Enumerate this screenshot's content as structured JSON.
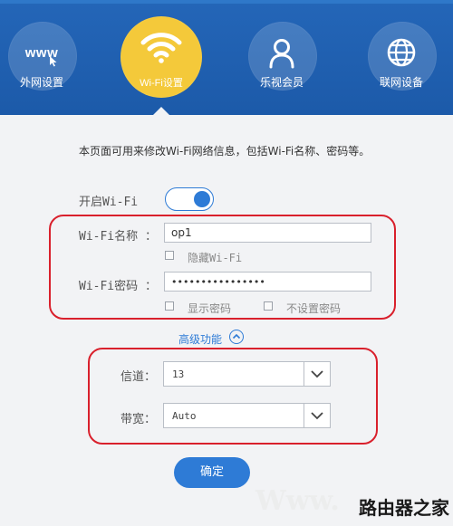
{
  "nav": {
    "items": [
      {
        "label": "外网设置",
        "icon": "www-icon"
      },
      {
        "label": "Wi-Fi设置",
        "icon": "wifi-icon",
        "active": true
      },
      {
        "label": "乐视会员",
        "icon": "user-icon"
      },
      {
        "label": "联网设备",
        "icon": "globe-icon"
      }
    ],
    "www_text": "www"
  },
  "description": "本页面可用来修改Wi-Fi网络信息，包括Wi-Fi名称、密码等。",
  "wifi_toggle": {
    "label": "开启Wi-Fi",
    "on": true
  },
  "wifi_name": {
    "label": "Wi-Fi名称 ：",
    "value": "op1",
    "hide_label": "隐藏Wi-Fi"
  },
  "wifi_password": {
    "label": "Wi-Fi密码 ：",
    "value": "••••••••••••••••",
    "show_label": "显示密码",
    "no_password_label": "不设置密码"
  },
  "advanced": {
    "label": "高级功能"
  },
  "channel": {
    "label": "信道：",
    "value": "13"
  },
  "bandwidth": {
    "label": "带宽：",
    "value": "Auto"
  },
  "confirm_label": "确定",
  "watermark": {
    "left": "Www.",
    "right": "路由器之家"
  },
  "colors": {
    "header": "#1f5fb0",
    "accent": "#2e7bd6",
    "active_nav": "#f4c93a",
    "annotation_red": "#d9202c"
  }
}
